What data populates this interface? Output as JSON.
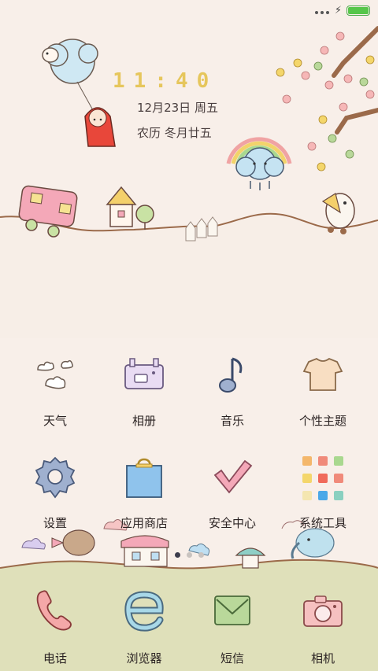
{
  "status_bar": {
    "battery_level": 1.0,
    "battery_color": "#56c64a"
  },
  "lock_widget": {
    "time": "11:40",
    "date": "12月23日 周五",
    "lunar": "农历 冬月廿五",
    "time_color": "#e6c65c"
  },
  "apps": [
    {
      "label": "天气",
      "icon": "weather-icon"
    },
    {
      "label": "相册",
      "icon": "gallery-icon"
    },
    {
      "label": "音乐",
      "icon": "music-icon"
    },
    {
      "label": "个性主题",
      "icon": "themes-icon"
    },
    {
      "label": "设置",
      "icon": "settings-icon"
    },
    {
      "label": "应用商店",
      "icon": "app-store-icon"
    },
    {
      "label": "安全中心",
      "icon": "security-icon"
    },
    {
      "label": "系统工具",
      "icon": "system-tools-icon"
    }
  ],
  "pager": {
    "pages": 3,
    "current": 1
  },
  "dock": [
    {
      "label": "电话",
      "icon": "phone-icon"
    },
    {
      "label": "浏览器",
      "icon": "browser-icon"
    },
    {
      "label": "短信",
      "icon": "messages-icon"
    },
    {
      "label": "相机",
      "icon": "camera-icon"
    }
  ]
}
